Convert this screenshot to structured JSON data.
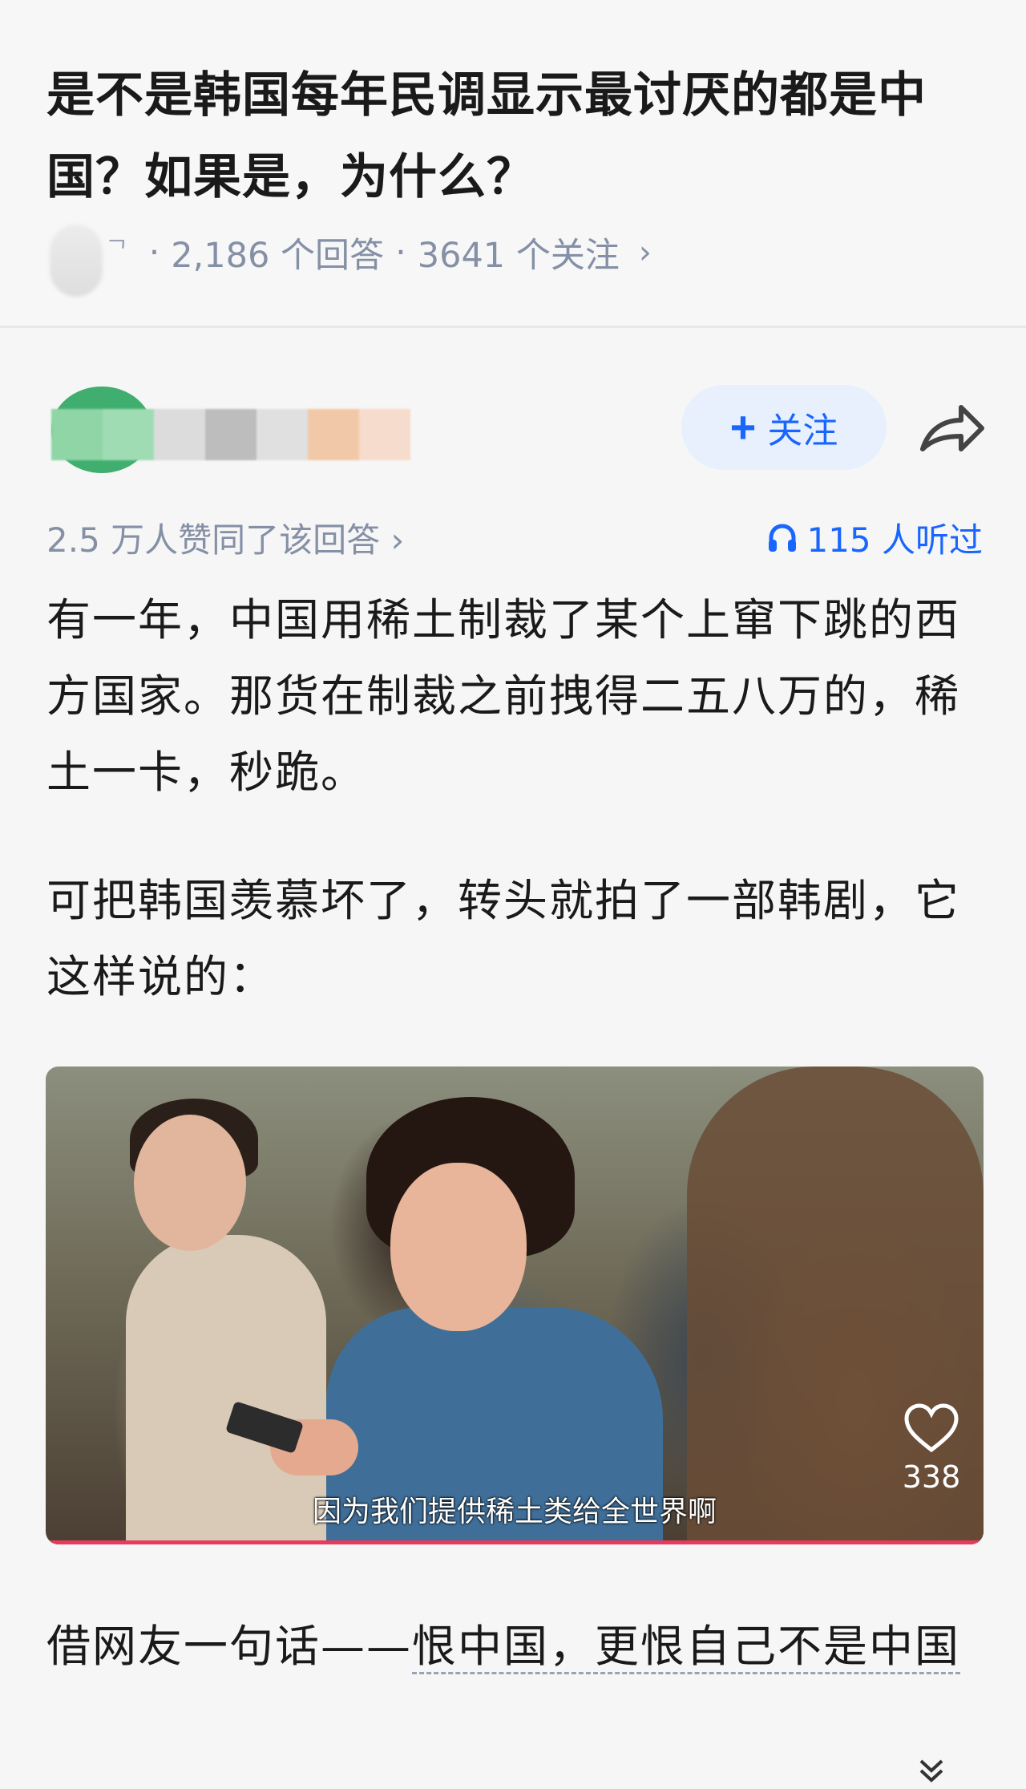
{
  "question": {
    "title": "是不是韩国每年民调显示最讨厌的都是中国？如果是，为什么？",
    "meta_fragment": "ᄀ",
    "answers": "2,186 个回答",
    "followers": "3641 个关注",
    "separator": "·",
    "chevron": "›"
  },
  "author": {
    "follow_label": "关注",
    "follow_icon": "+",
    "share_icon": "share-icon",
    "name_blur_colors": [
      "#8fd5a6",
      "#9fdcb4",
      "#dcdcdc",
      "#bdbdbd",
      "#e0e0e0",
      "#f2c9a8",
      "#f6dccc"
    ],
    "avatar_color": "#3fae6e"
  },
  "stats": {
    "votes": "2.5 万人赞同了该回答 ›",
    "listen": "115 人听过",
    "listen_icon": "headphones-icon"
  },
  "content": {
    "para1": "有一年，中国用稀土制裁了某个上窜下跳的西方国家。那货在制裁之前拽得二五八万的，稀土一卡，秒跪。",
    "para2": "可把韩国羡慕坏了，转头就拍了一部韩剧，它这样说的：",
    "video_subtitle": "因为我们提供稀土类给全世界啊",
    "video_likes": "338",
    "para3_prefix": "借网友一句话——",
    "para3_highlight": "恨中国，更恨自己不是中国"
  },
  "colors": {
    "accent": "#1966ff",
    "meta": "#8590a6",
    "follow_bg": "#e8f0fd"
  }
}
